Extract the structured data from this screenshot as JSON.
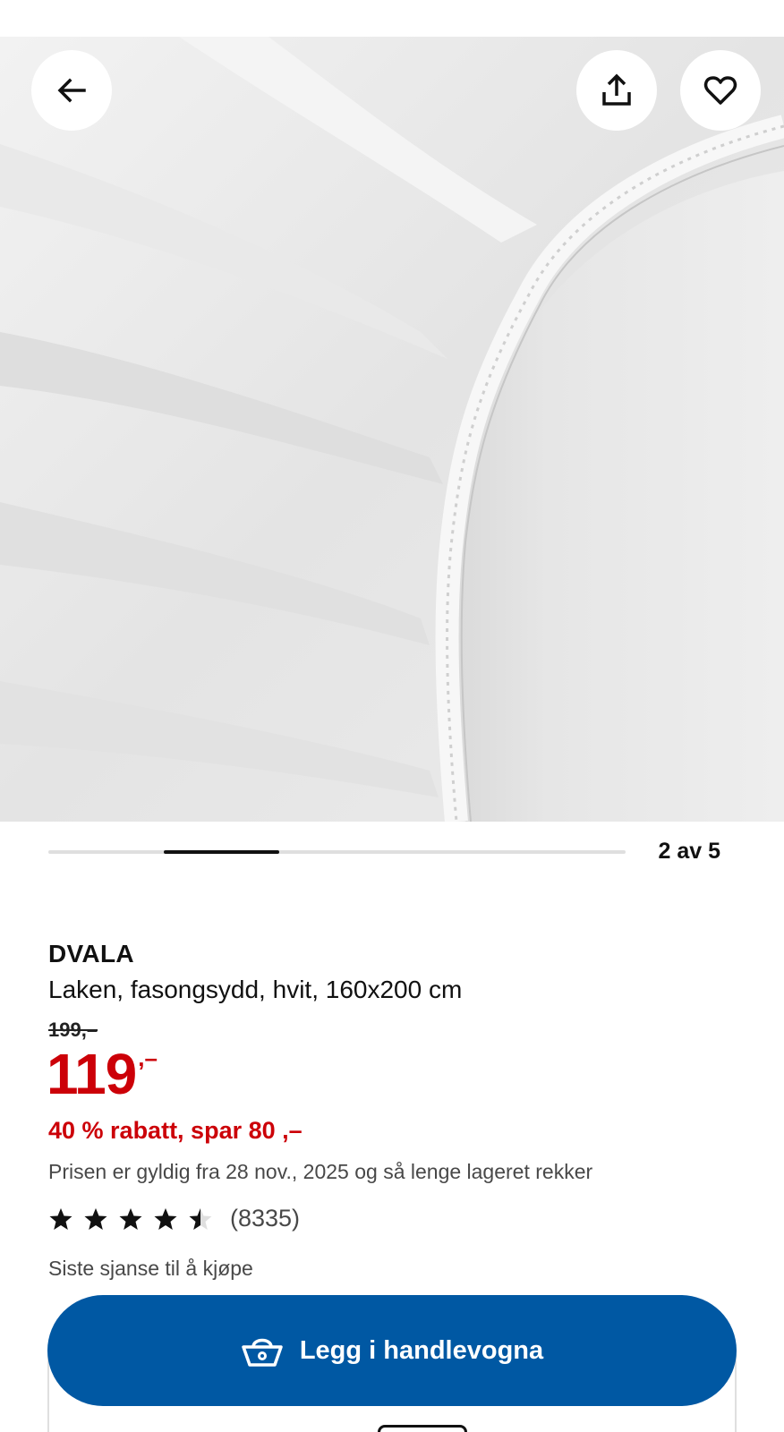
{
  "carousel": {
    "counter": "2 av 5",
    "current": 2,
    "total": 5
  },
  "header_buttons": {
    "back_icon": "arrow-left-icon",
    "share_icon": "share-icon",
    "favorite_icon": "heart-icon"
  },
  "product": {
    "brand": "DVALA",
    "description": "Laken, fasongsydd, hvit, 160x200 cm",
    "old_price": "199,–",
    "price_integer": "119",
    "price_decimal": ",–",
    "discount_text": "40 % rabatt, spar 80 ,–",
    "validity_text": "Prisen er gyldig fra 28 nov., 2025 og så lenge lageret rekker",
    "rating": 4.5,
    "rating_max": 5,
    "review_count": "(8335)",
    "availability_note": "Siste sjanse til å kjøpe"
  },
  "cart_button": {
    "label": "Legg i handlevogna",
    "icon": "shopping-basket-icon"
  },
  "colors": {
    "price_red": "#cc0008",
    "button_blue": "#0058a3",
    "text_primary": "#111111",
    "text_secondary": "#484848"
  }
}
